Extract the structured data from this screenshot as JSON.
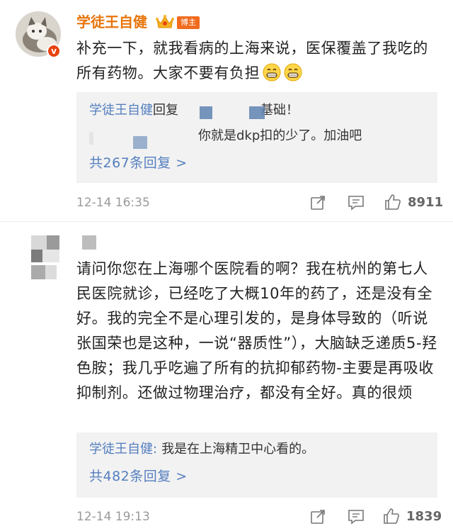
{
  "comments": [
    {
      "username": "学徒王自健",
      "badge": "博主",
      "body": "补充一下，就我看病的上海来说，医保覆盖了我吃的所有药物。大家不要有负担",
      "emoji_icons": [
        "grin-emoji-icon",
        "grin-emoji-icon"
      ],
      "replies": [
        {
          "user": "学徒王自健",
          "text": "回复",
          "tail": "基础！"
        },
        {
          "user": "",
          "text": "你就是dkp扣的少了。加油吧"
        }
      ],
      "more_replies": "共267条回复 >",
      "time": "12-14 16:35",
      "likes": "8911"
    },
    {
      "username": "",
      "body": "请问你您在上海哪个医院看的啊？我在杭州的第七人民医院就诊，已经吃了大概10年的药了，还是没有全好。我的完全不是心理引发的，是身体导致的（听说张国荣也是这种，一说“器质性”），大脑缺乏递质5-羟色胺；我几乎吃遍了所有的抗抑郁药物-主要是再吸收抑制剂。还做过物理治疗，都没有全好。真的很烦",
      "replies": [
        {
          "user": "学徒王自健:",
          "text": "我是在上海精卫中心看的。"
        }
      ],
      "more_replies": "共482条回复 >",
      "time": "12-14 19:13",
      "likes": "1839"
    }
  ],
  "colors": {
    "username_orange": "#e8750b",
    "reply_blue": "#557fbf",
    "reply_bg": "#f2f2f2",
    "meta_gray": "#9a9a9a"
  }
}
